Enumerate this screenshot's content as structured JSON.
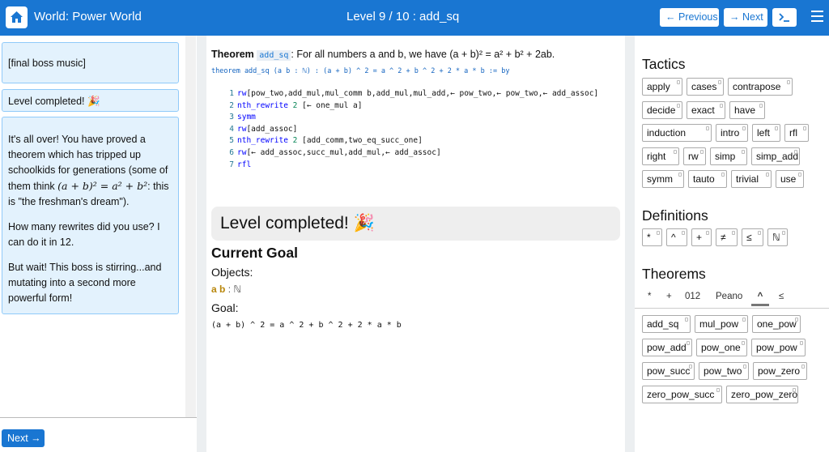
{
  "header": {
    "world_title": "World: Power World",
    "level_title": "Level 9 / 10 : add_sq",
    "prev_label": "Previous",
    "next_label": "Next",
    "prev_arrow": "←",
    "next_arrow": "→"
  },
  "left_panel": {
    "messages": [
      "[final boss music]",
      "Level completed! 🎉"
    ],
    "boss": {
      "p1_start": "It's all over! You have proved a theorem which has tripped up schoolkids for generations (some of them think",
      "p1_math": "(a + b)² = a² + b²",
      "p1_end": ": this is \"the freshman's dream\").",
      "p2": "How many rewrites did you use? I can do it in 12.",
      "p3": "But wait! This boss is stirring...and mutating into a second more powerful form!"
    },
    "next_button": "Next →"
  },
  "theorem": {
    "label": "Theorem",
    "name": "add_sq",
    "statement": ": For all numbers a and b, we have (a + b)² = a² + b² + 2ab.",
    "signature": "theorem add_sq (a b : ℕ) : (a + b) ^ 2 = a ^ 2 + b ^ 2 + 2 * a * b := by"
  },
  "proof_lines": [
    {
      "n": "1",
      "kw": "rw",
      "rest": "[pow_two,add_mul,mul_comm b,add_mul,mul_add,← pow_two,← pow_two,← add_assoc]"
    },
    {
      "n": "2",
      "kw": "nth_rewrite",
      "num": " 2 ",
      "rest": "[← one_mul a]"
    },
    {
      "n": "3",
      "kw": "symm",
      "rest": ""
    },
    {
      "n": "4",
      "kw": "rw",
      "rest": "[add_assoc]"
    },
    {
      "n": "5",
      "kw": "nth_rewrite",
      "num": " 2 ",
      "rest": "[add_comm,two_eq_succ_one]"
    },
    {
      "n": "6",
      "kw": "rw",
      "rest": "[← add_assoc,succ_mul,add_mul,← add_assoc]"
    },
    {
      "n": "7",
      "kw": "rfl",
      "rest": ""
    }
  ],
  "goal_panel": {
    "completed": "Level completed! 🎉",
    "current_goal": "Current Goal",
    "objects_label": "Objects:",
    "objects_vars": "a b",
    "objects_type": ": ℕ",
    "goal_label": "Goal:",
    "goal": "(a + b) ^ 2 = a ^ 2 + b ^ 2 + 2 * a * b"
  },
  "tactics": {
    "heading": "Tactics",
    "items": [
      "apply",
      "cases",
      "contrapose",
      "decide",
      "exact",
      "have",
      "induction",
      "intro",
      "left",
      "rfl",
      "right",
      "rw",
      "simp",
      "simp_add",
      "symm",
      "tauto",
      "trivial",
      "use"
    ]
  },
  "definitions": {
    "heading": "Definitions",
    "items": [
      "*",
      "^",
      "+",
      "≠",
      "≤",
      "ℕ"
    ]
  },
  "theorems": {
    "heading": "Theorems",
    "tabs": [
      "*",
      "+",
      "012",
      "Peano",
      "^",
      "≤"
    ],
    "active_tab": "^",
    "items": [
      "add_sq",
      "mul_pow",
      "one_pow",
      "pow_add",
      "pow_one",
      "pow_pow",
      "pow_succ",
      "pow_two",
      "pow_zero",
      "zero_pow_succ",
      "zero_pow_zero"
    ]
  },
  "colors": {
    "primary": "#1976d2",
    "message_bg": "#e3f2fd",
    "object_var": "#b8860b"
  }
}
